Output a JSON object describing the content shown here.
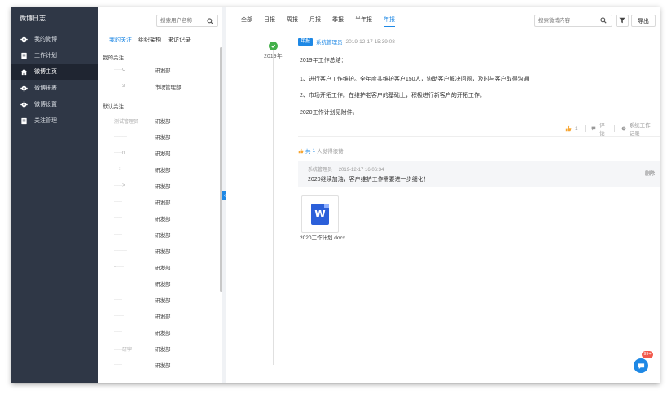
{
  "sidebar": {
    "title": "微博日志",
    "items": [
      {
        "label": "我的微博",
        "icon": "gear-icon",
        "active": false
      },
      {
        "label": "工作计划",
        "icon": "document-icon",
        "active": false
      },
      {
        "label": "微博主页",
        "icon": "home-icon",
        "active": true
      },
      {
        "label": "微博报表",
        "icon": "gear-icon",
        "active": false
      },
      {
        "label": "微博设置",
        "icon": "gear-icon",
        "active": false
      },
      {
        "label": "关注管理",
        "icon": "document-icon",
        "active": false
      }
    ]
  },
  "userpanel": {
    "search_placeholder": "搜索用户名称",
    "tabs": [
      "我的关注",
      "组织架构",
      "来访记录"
    ],
    "my_follow_title": "我的关注",
    "my_follow": [
      {
        "name": "·····C",
        "dept": "研发部"
      },
      {
        "name": "·····3",
        "dept": "市场管理部"
      }
    ],
    "default_title": "默认关注",
    "default_follow": [
      {
        "name": "测试管理员",
        "dept": "研发部"
      },
      {
        "name": "········",
        "dept": "研发部"
      },
      {
        "name": "·····h",
        "dept": "研发部"
      },
      {
        "name": "···:···",
        "dept": "研发部"
      },
      {
        "name": "·····>",
        "dept": "研发部"
      },
      {
        "name": "·····",
        "dept": "研发部"
      },
      {
        "name": "·····",
        "dept": "研发部"
      },
      {
        "name": "·····",
        "dept": "研发部"
      },
      {
        "name": "········",
        "dept": "研发部"
      },
      {
        "name": "-·····",
        "dept": "研发部"
      },
      {
        "name": "·····",
        "dept": "研发部"
      },
      {
        "name": "·····",
        "dept": "研发部"
      },
      {
        "name": "······",
        "dept": "研发部"
      },
      {
        "name": "·····",
        "dept": "研发部"
      },
      {
        "name": "·····研宇",
        "dept": "研发部"
      },
      {
        "name": "·····",
        "dept": "研发部"
      }
    ]
  },
  "main": {
    "filters": [
      "全部",
      "日报",
      "周报",
      "月报",
      "季报",
      "半年报",
      "年报"
    ],
    "active_filter": "年报",
    "search_placeholder": "搜索微博内容",
    "export_label": "导出",
    "year": "2019年",
    "post": {
      "badge": "年报",
      "author": "系统管理员",
      "time": "2019-12-17 15:39:08",
      "lines": [
        "2019年工作总结：",
        "1、进行客户工作维护。全年度共维护客户150人，协助客户解决问题，及时与客户取得沟通",
        "2、市场开拓工作。在维护老客户的基础上，积极进行新客户的开拓工作。",
        "2020工作计划见附件。"
      ]
    },
    "actions": {
      "like_count": "1",
      "comment": "评论",
      "record": "系统工作记录"
    },
    "likers": {
      "prefix": "共",
      "count": "1",
      "suffix": "人觉得很赞"
    },
    "comment": {
      "author": "系统管理员",
      "time": "2019-12-17 16:06:34",
      "text": "2020继续加油，客户维护工作需要进一步细化！",
      "delete": "删除"
    },
    "attachment": {
      "name": "2020工作计划.docx",
      "icon": "word-doc-icon"
    }
  },
  "chat": {
    "badge": "99+",
    "icon": "chat-icon"
  },
  "colors": {
    "sidebar_bg": "#2f3746",
    "accent": "#1e88e5",
    "success": "#43b04a"
  }
}
